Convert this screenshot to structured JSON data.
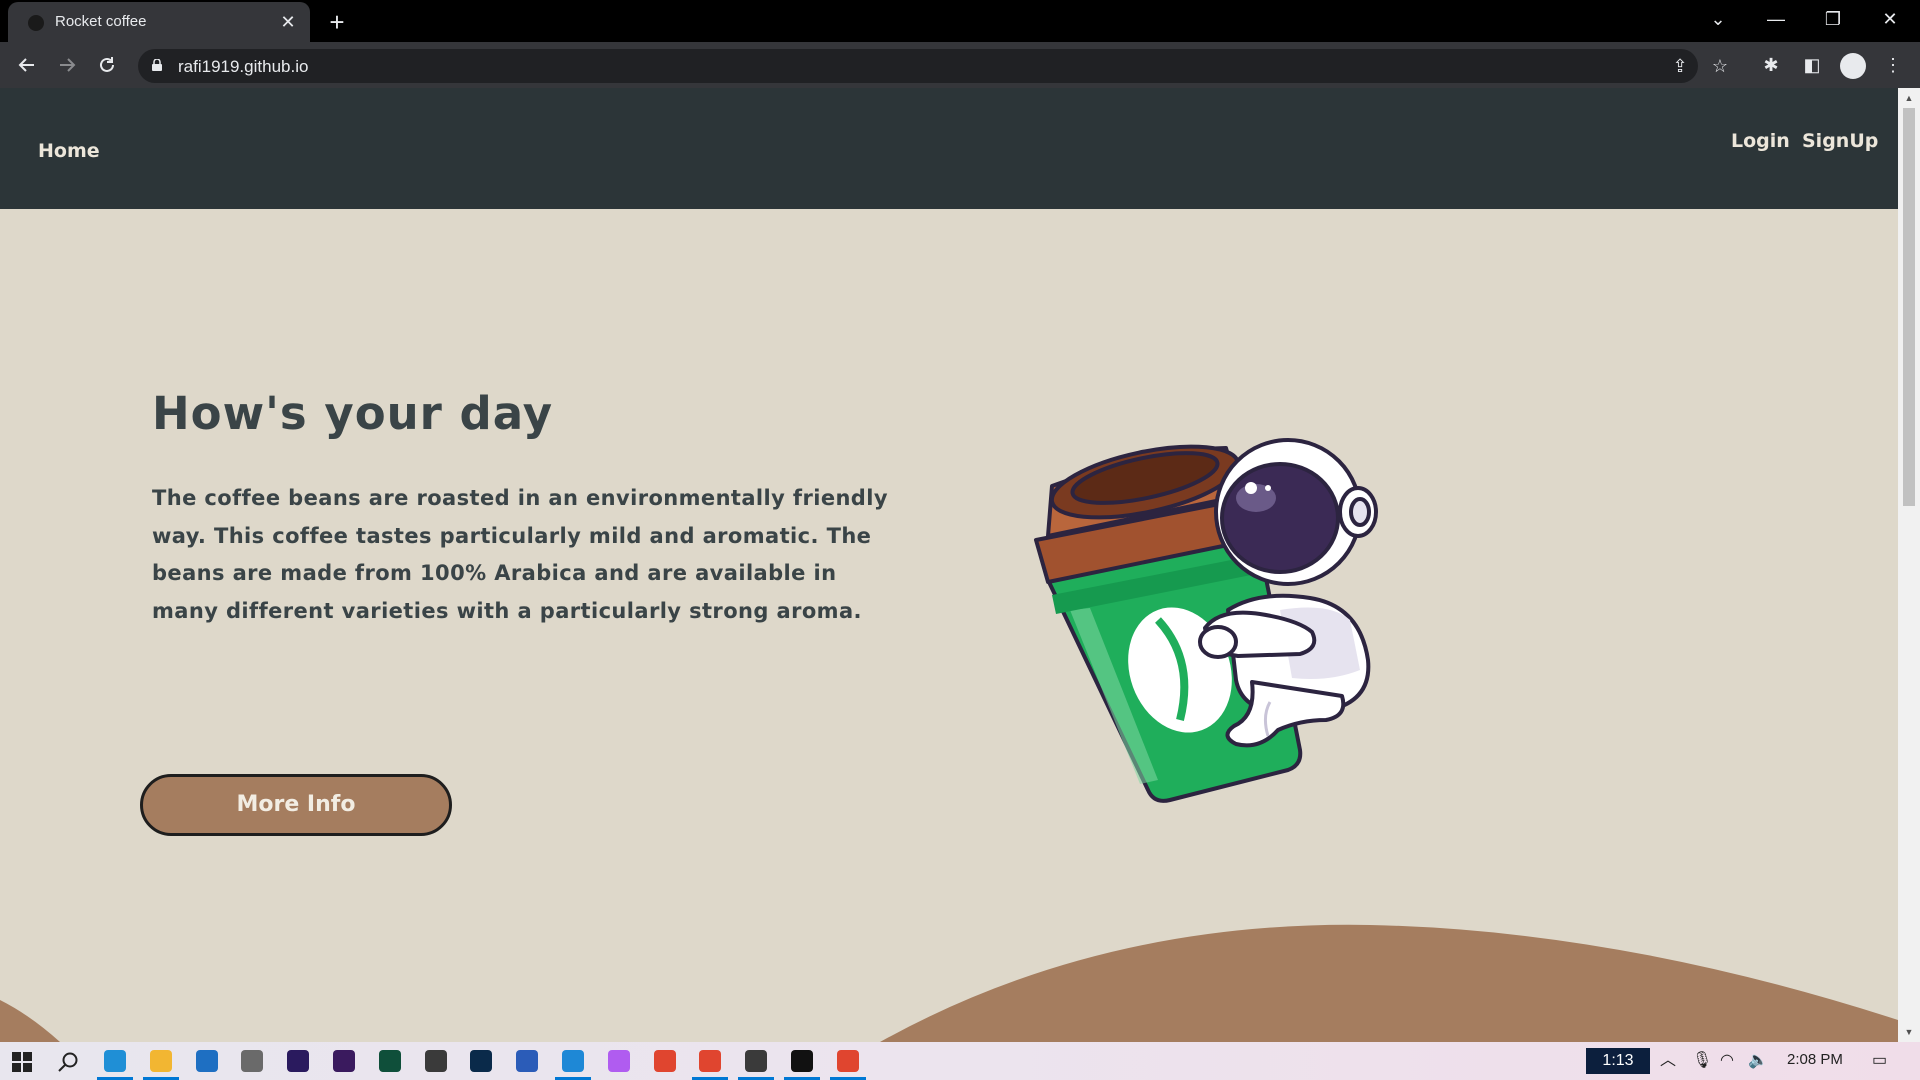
{
  "browser": {
    "tab_title": "Rocket coffee",
    "tab_close": "✕",
    "new_tab": "+",
    "url": "rafi1919.github.io",
    "window_controls": {
      "tabsearch": "⌄",
      "minimize": "—",
      "restore": "❐",
      "close": "✕"
    }
  },
  "site": {
    "nav": {
      "home": "Home",
      "login": "Login",
      "signup": "SignUp"
    },
    "hero": {
      "title": "How's your day",
      "text": "The coffee beans are roasted in an environmentally friendly way. This coffee tastes particularly mild and aromatic. The beans are made from 100% Arabica and are available in many different varieties with a particularly strong aroma.",
      "button": "More Info"
    }
  },
  "taskbar": {
    "clock_badge": "1:13",
    "time": "2:08 PM",
    "apps": [
      {
        "name": "edge-app-icon",
        "color": "#1f8fd6"
      },
      {
        "name": "file-explorer-app-icon",
        "color": "#f2b632"
      },
      {
        "name": "mail-app-icon",
        "color": "#1e6fc2"
      },
      {
        "name": "twitch-app-icon",
        "color": "#6a6a6a"
      },
      {
        "name": "premiere-app-icon",
        "color": "#2a1a5e"
      },
      {
        "name": "after-effects-app-icon",
        "color": "#3a1a5e"
      },
      {
        "name": "audition-app-icon",
        "color": "#0f4f3a"
      },
      {
        "name": "sublime-app-icon",
        "color": "#3a3a3a"
      },
      {
        "name": "photoshop-app-icon",
        "color": "#0a2a4a"
      },
      {
        "name": "word-app-icon",
        "color": "#2b5cb8"
      },
      {
        "name": "vscode-app-icon",
        "color": "#1e88d6"
      },
      {
        "name": "figma-app-icon",
        "color": "#b05cf0"
      },
      {
        "name": "chrome-app-icon",
        "color": "#e0452f"
      },
      {
        "name": "chrome-profile-app-icon",
        "color": "#e0452f"
      },
      {
        "name": "sticky-app-icon",
        "color": "#3a3a3a"
      },
      {
        "name": "terminal-app-icon",
        "color": "#111111"
      },
      {
        "name": "chrome-active-app-icon",
        "color": "#e0452f"
      }
    ]
  },
  "colors": {
    "page_bg": "#ded8ca",
    "navbar_bg": "#2c3538",
    "accent_brown": "#a57d5f",
    "cup_green": "#1fae5b",
    "text_dark": "#3a4447"
  }
}
